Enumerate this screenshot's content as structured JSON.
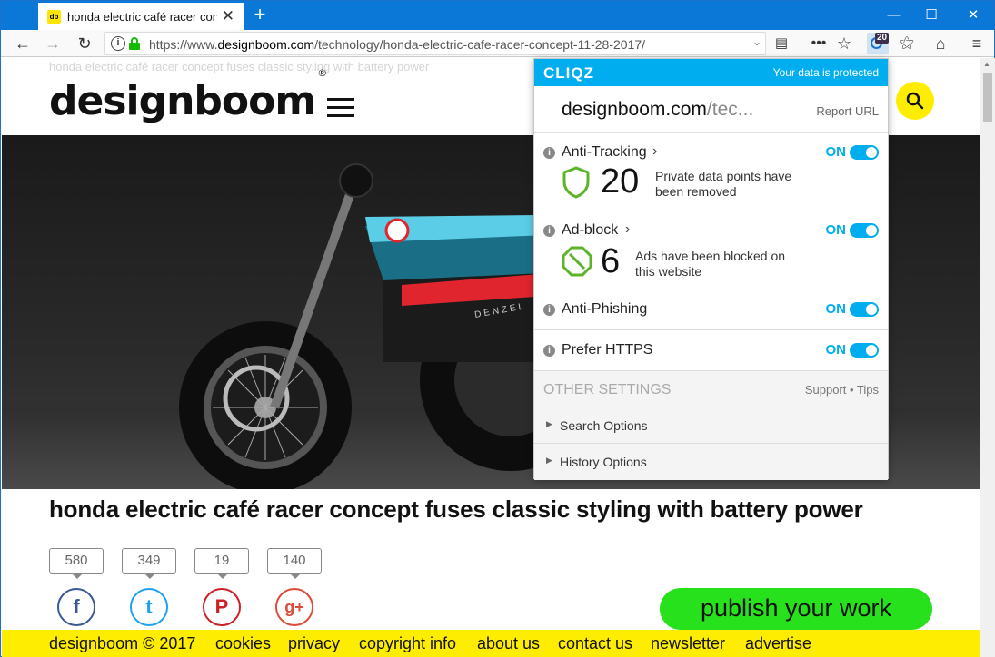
{
  "browser": {
    "tab_title": "honda electric café racer concept fuses classic styling with battery power",
    "tab_favicon_text": "db",
    "new_tab": "+",
    "url_prefix": "https://www.",
    "url_domain": "designboom.com",
    "url_path": "/technology/honda-electric-cafe-racer-concept-11-28-2017/",
    "cliqz_badge": "20"
  },
  "page": {
    "ghost_title": "honda electric café racer concept fuses classic styling with battery power",
    "logo": "designboom",
    "logo_mark": "®",
    "headline": "honda electric café racer concept fuses classic styling with battery power",
    "bike_brand": "DENZEL",
    "share": [
      {
        "count": "580",
        "network": "facebook",
        "glyph": "f",
        "color": "#3b5998"
      },
      {
        "count": "349",
        "network": "twitter",
        "glyph": "t",
        "color": "#1da1f2"
      },
      {
        "count": "19",
        "network": "pinterest",
        "glyph": "P",
        "color": "#cb2027"
      },
      {
        "count": "140",
        "network": "google-plus",
        "glyph": "g+",
        "color": "#dd4b39"
      }
    ],
    "publish": "publish your work",
    "footer": [
      "designboom © 2017",
      "cookies",
      "privacy",
      "copyright info",
      "about us",
      "contact us",
      "newsletter",
      "advertise"
    ]
  },
  "popup": {
    "logo": "CLIQZ",
    "protected": "Your data is protected",
    "domain_main": "designboom.com",
    "domain_rest": "/tec...",
    "report_url": "Report URL",
    "anti_tracking": {
      "label": "Anti-Tracking",
      "state": "ON",
      "count": "20",
      "desc": "Private data points have been removed"
    },
    "ad_block": {
      "label": "Ad-block",
      "state": "ON",
      "count": "6",
      "desc": "Ads have been blocked on this website"
    },
    "anti_phishing": {
      "label": "Anti-Phishing",
      "state": "ON"
    },
    "prefer_https": {
      "label": "Prefer HTTPS",
      "state": "ON"
    },
    "other_settings": "OTHER SETTINGS",
    "support_tips": "Support • Tips",
    "search_options": "Search Options",
    "history_options": "History Options"
  }
}
